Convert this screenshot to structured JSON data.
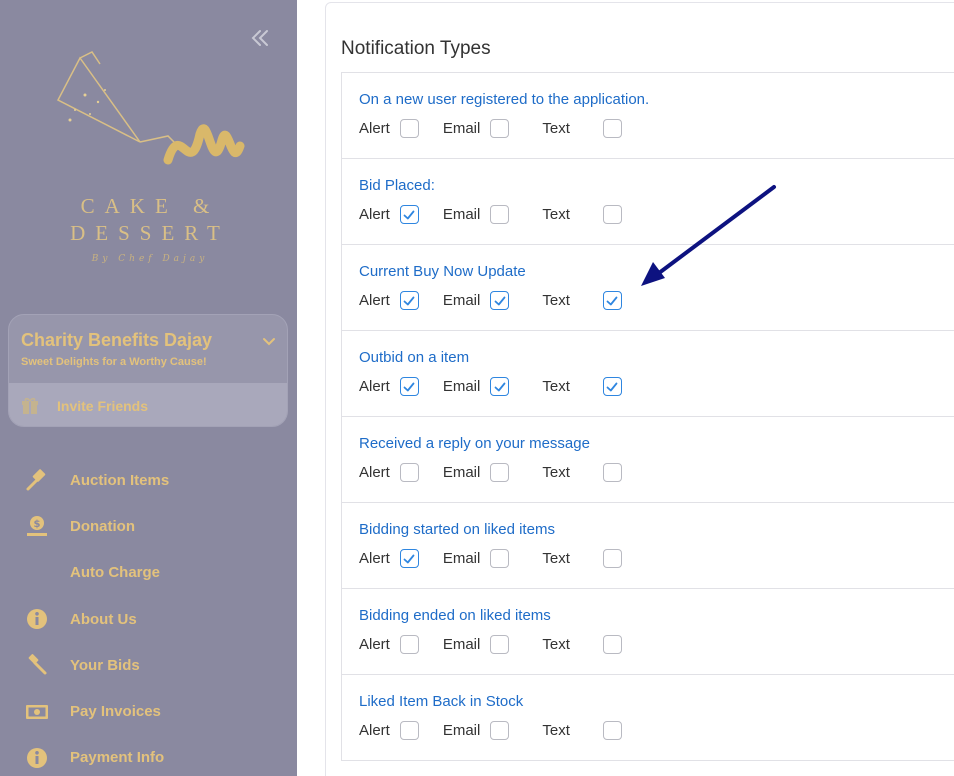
{
  "brand": {
    "line1": "CAKE &",
    "line2": "DESSERT",
    "byline": "By Chef Dajay"
  },
  "org": {
    "name": "Charity Benefits Dajay",
    "tagline": "Sweet Delights for a Worthy Cause!",
    "invite_label": "Invite Friends"
  },
  "nav": [
    {
      "label": "Auction Items",
      "icon": "gavel-icon"
    },
    {
      "label": "Donation",
      "icon": "donation-icon"
    },
    {
      "label": "Auto Charge",
      "icon": ""
    },
    {
      "label": "About Us",
      "icon": "info-icon"
    },
    {
      "label": "Your Bids",
      "icon": "gavel-icon"
    },
    {
      "label": "Pay Invoices",
      "icon": "money-icon"
    },
    {
      "label": "Payment Info",
      "icon": "info-icon"
    }
  ],
  "section_title": "Notification Types",
  "option_labels": {
    "alert": "Alert",
    "email": "Email",
    "text": "Text"
  },
  "notifications": [
    {
      "title": "On a new user registered to the application.",
      "alert": false,
      "email": false,
      "text": false
    },
    {
      "title": "Bid Placed:",
      "alert": true,
      "email": false,
      "text": false
    },
    {
      "title": "Current Buy Now Update",
      "alert": true,
      "email": true,
      "text": true
    },
    {
      "title": "Outbid on a item",
      "alert": true,
      "email": true,
      "text": true
    },
    {
      "title": "Received a reply on your message",
      "alert": false,
      "email": false,
      "text": false
    },
    {
      "title": "Bidding started on liked items",
      "alert": true,
      "email": false,
      "text": false
    },
    {
      "title": "Bidding ended on liked items",
      "alert": false,
      "email": false,
      "text": false
    },
    {
      "title": "Liked Item Back in Stock",
      "alert": false,
      "email": false,
      "text": false
    }
  ],
  "colors": {
    "sidebar_bg": "#8a89a0",
    "gold": "#e3c27c",
    "link_blue": "#1e6cc8",
    "check_blue": "#2f86e0",
    "arrow_navy": "#0d1280"
  }
}
